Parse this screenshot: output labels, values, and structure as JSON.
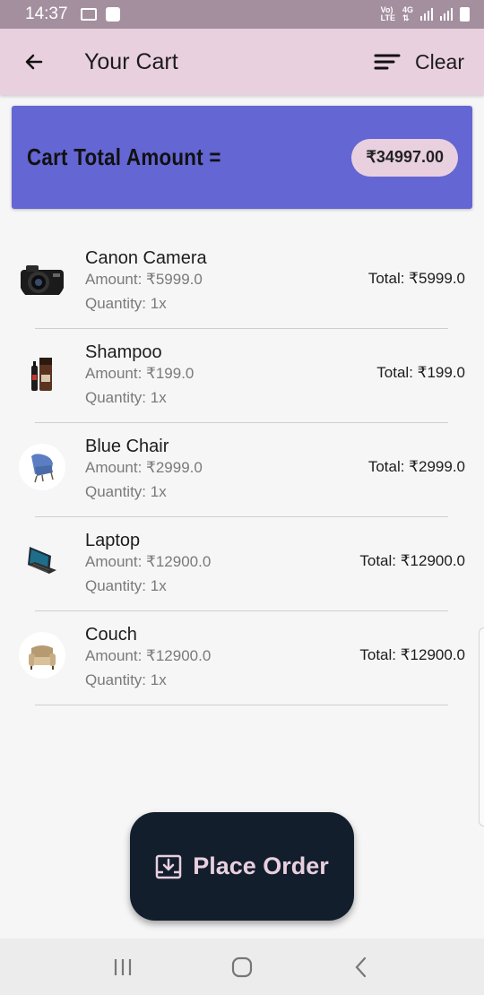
{
  "status_bar": {
    "time": "14:37",
    "network": "Vo) 4G LTE"
  },
  "app_bar": {
    "title": "Your Cart",
    "clear_label": "Clear"
  },
  "summary": {
    "label": "Cart Total Amount =",
    "amount": "₹34997.00"
  },
  "items": [
    {
      "name": "Canon Camera",
      "amount": "Amount: ₹5999.0",
      "quantity": "Quantity: 1x",
      "total": "Total: ₹5999.0",
      "icon": "camera-icon"
    },
    {
      "name": "Shampoo",
      "amount": "Amount: ₹199.0",
      "quantity": "Quantity: 1x",
      "total": "Total: ₹199.0",
      "icon": "shampoo-bottle-icon"
    },
    {
      "name": "Blue Chair",
      "amount": "Amount: ₹2999.0",
      "quantity": "Quantity: 1x",
      "total": "Total: ₹2999.0",
      "icon": "chair-icon"
    },
    {
      "name": "Laptop",
      "amount": "Amount: ₹12900.0",
      "quantity": "Quantity: 1x",
      "total": "Total: ₹12900.0",
      "icon": "laptop-icon"
    },
    {
      "name": "Couch",
      "amount": "Amount: ₹12900.0",
      "quantity": "Quantity: 1x",
      "total": "Total: ₹12900.0",
      "icon": "couch-icon"
    }
  ],
  "place_order": {
    "label": "Place Order"
  },
  "colors": {
    "accent": "#6466d4",
    "app_bar": "#e8d0df",
    "button_bg": "#131e2d",
    "status_bar": "#a48f9f"
  }
}
